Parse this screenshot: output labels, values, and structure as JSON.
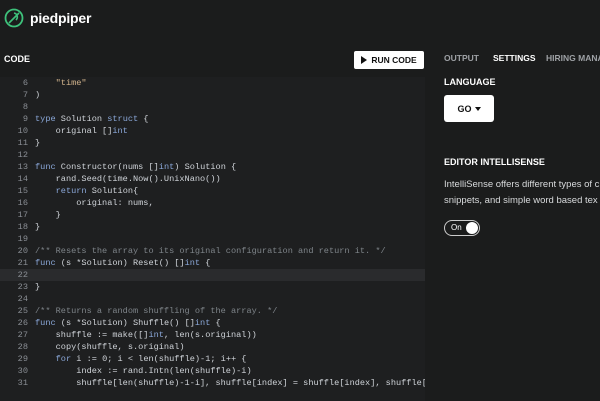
{
  "app": {
    "brand": "piedpiper"
  },
  "editor": {
    "label": "CODE",
    "run_label": "RUN CODE",
    "lines": [
      {
        "n": "6",
        "text": "    \"time\""
      },
      {
        "n": "7",
        "text": ")"
      },
      {
        "n": "8",
        "text": ""
      },
      {
        "n": "9",
        "text": "type Solution struct {"
      },
      {
        "n": "10",
        "text": "    original []int"
      },
      {
        "n": "11",
        "text": "}"
      },
      {
        "n": "12",
        "text": ""
      },
      {
        "n": "13",
        "text": "func Constructor(nums []int) Solution {"
      },
      {
        "n": "14",
        "text": "    rand.Seed(time.Now().UnixNano())"
      },
      {
        "n": "15",
        "text": "    return Solution{"
      },
      {
        "n": "16",
        "text": "        original: nums,"
      },
      {
        "n": "17",
        "text": "    }"
      },
      {
        "n": "18",
        "text": "}"
      },
      {
        "n": "19",
        "text": ""
      },
      {
        "n": "20",
        "text": "/** Resets the array to its original configuration and return it. */"
      },
      {
        "n": "21",
        "text": "func (s *Solution) Reset() []int {"
      },
      {
        "n": "22",
        "text": ""
      },
      {
        "n": "23",
        "text": "}"
      },
      {
        "n": "24",
        "text": ""
      },
      {
        "n": "25",
        "text": "/** Returns a random shuffling of the array. */"
      },
      {
        "n": "26",
        "text": "func (s *Solution) Shuffle() []int {"
      },
      {
        "n": "27",
        "text": "    shuffle := make([]int, len(s.original))"
      },
      {
        "n": "28",
        "text": "    copy(shuffle, s.original)"
      },
      {
        "n": "29",
        "text": "    for i := 0; i < len(shuffle)-1; i++ {"
      },
      {
        "n": "30",
        "text": "        index := rand.Intn(len(shuffle)-i)"
      },
      {
        "n": "31",
        "text": "        shuffle[len(shuffle)-1-i], shuffle[index] = shuffle[index], shuffle[len(sh"
      }
    ]
  },
  "panel": {
    "tabs": [
      {
        "label": "OUTPUT",
        "active": false
      },
      {
        "label": "SETTINGS",
        "active": true
      },
      {
        "label": "HIRING MANAG",
        "active": false
      }
    ],
    "language_title": "LANGUAGE",
    "language_value": "GO",
    "intellisense_title": "EDITOR INTELLISENSE",
    "intellisense_desc": [
      "IntelliSense offers different types of c",
      "snippets, and simple word based tex"
    ],
    "toggle_label": "On"
  }
}
